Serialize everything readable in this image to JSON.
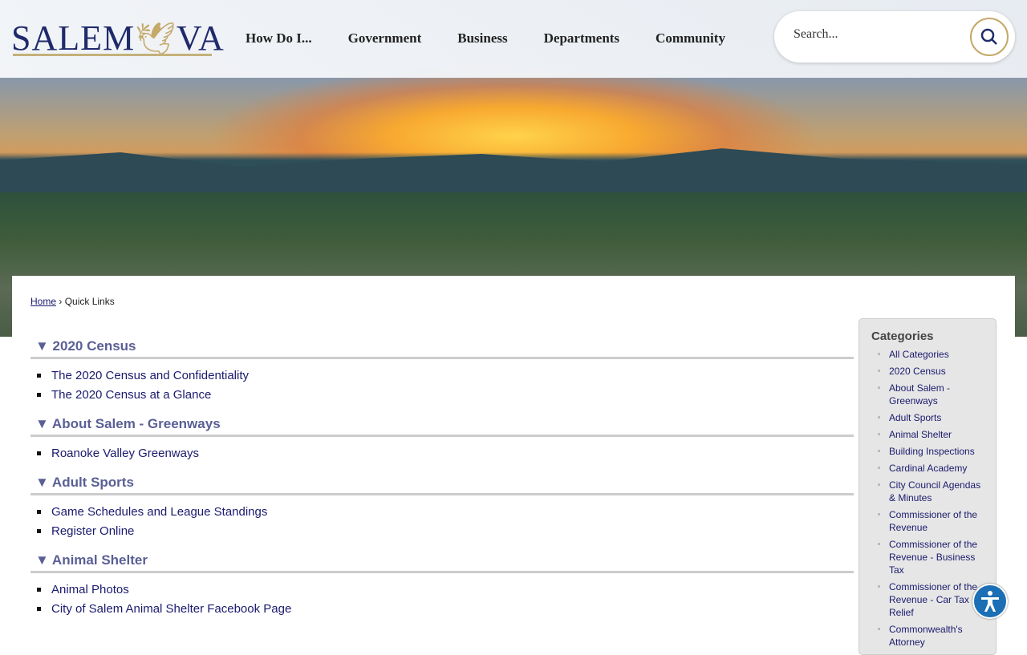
{
  "header": {
    "logo": "SALEM VA",
    "nav": [
      "How Do I...",
      "Government",
      "Business",
      "Departments",
      "Community"
    ],
    "search_placeholder": "Search..."
  },
  "breadcrumb": {
    "home": "Home",
    "current": "Quick Links",
    "sep": "›"
  },
  "sections": [
    {
      "title": "▼ 2020 Census",
      "links": [
        "The 2020 Census and Confidentiality",
        "The 2020 Census at a Glance"
      ]
    },
    {
      "title": "▼ About Salem - Greenways",
      "links": [
        "Roanoke Valley Greenways"
      ]
    },
    {
      "title": "▼ Adult Sports",
      "links": [
        "Game Schedules and League Standings",
        "Register Online"
      ]
    },
    {
      "title": "▼ Animal Shelter",
      "links": [
        "Animal Photos",
        "City of Salem Animal Shelter Facebook Page"
      ]
    }
  ],
  "categories": {
    "title": "Categories",
    "items": [
      "All Categories",
      "2020 Census",
      "About Salem - Greenways",
      "Adult Sports",
      "Animal Shelter",
      "Building Inspections",
      "Cardinal Academy",
      "City Council Agendas & Minutes",
      "Commissioner of the Revenue",
      "Commissioner of the Revenue - Business Tax",
      "Commissioner of the Revenue - Car Tax Relief",
      "Commonwealth's Attorney"
    ]
  }
}
